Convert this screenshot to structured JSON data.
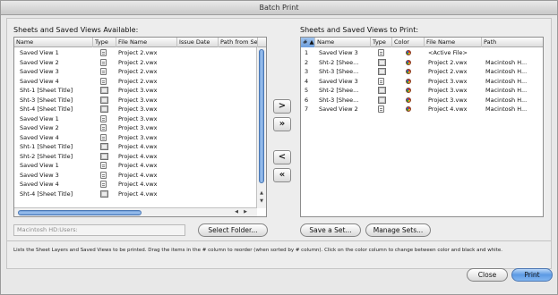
{
  "window": {
    "title": "Batch Print"
  },
  "available": {
    "label": "Sheets and Saved Views Available:",
    "columns": [
      "Name",
      "Type",
      "File Name",
      "Issue Date",
      "Path from Se"
    ],
    "rows": [
      {
        "name": "Saved View 1",
        "type": "doc",
        "file": "Project 2.vwx"
      },
      {
        "name": "Saved View 2",
        "type": "doc",
        "file": "Project 2.vwx"
      },
      {
        "name": "Saved View 3",
        "type": "doc",
        "file": "Project 2.vwx"
      },
      {
        "name": "Saved View 4",
        "type": "doc",
        "file": "Project 2.vwx"
      },
      {
        "name": "Sht-1 [Sheet Title]",
        "type": "sheet",
        "file": "Project 3.vwx"
      },
      {
        "name": "Sht-3 [Sheet Title]",
        "type": "sheet",
        "file": "Project 3.vwx"
      },
      {
        "name": "Sht-4 [Sheet Title]",
        "type": "sheet",
        "file": "Project 3.vwx"
      },
      {
        "name": "Saved View 1",
        "type": "doc",
        "file": "Project 3.vwx"
      },
      {
        "name": "Saved View 2",
        "type": "doc",
        "file": "Project 3.vwx"
      },
      {
        "name": "Saved View 4",
        "type": "doc",
        "file": "Project 3.vwx"
      },
      {
        "name": "Sht-1 [Sheet Title]",
        "type": "sheet",
        "file": "Project 4.vwx"
      },
      {
        "name": "Sht-2 [Sheet Title]",
        "type": "sheet",
        "file": "Project 4.vwx"
      },
      {
        "name": "Saved View 1",
        "type": "doc",
        "file": "Project 4.vwx"
      },
      {
        "name": "Saved View 3",
        "type": "doc",
        "file": "Project 4.vwx"
      },
      {
        "name": "Saved View 4",
        "type": "doc",
        "file": "Project 4.vwx"
      },
      {
        "name": "Sht-4 [Sheet Title]",
        "type": "sheet",
        "file": "Project 4.vwx"
      }
    ]
  },
  "to_print": {
    "label": "Sheets and Saved Views to Print:",
    "columns": [
      "#",
      "Name",
      "Type",
      "Color",
      "File Name",
      "Path"
    ],
    "rows": [
      {
        "num": "1",
        "name": "Saved View 3",
        "type": "doc",
        "file": "<Active File>",
        "path": ""
      },
      {
        "num": "2",
        "name": "Sht-2 [Shee...",
        "type": "sheet",
        "file": "Project 2.vwx",
        "path": "Macintosh H..."
      },
      {
        "num": "3",
        "name": "Sht-3 [Shee...",
        "type": "sheet",
        "file": "Project 2.vwx",
        "path": "Macintosh H..."
      },
      {
        "num": "4",
        "name": "Saved View 3",
        "type": "doc",
        "file": "Project 3.vwx",
        "path": "Macintosh H..."
      },
      {
        "num": "5",
        "name": "Sht-2 [Shee...",
        "type": "sheet",
        "file": "Project 3.vwx",
        "path": "Macintosh H..."
      },
      {
        "num": "6",
        "name": "Sht-3 [Shee...",
        "type": "sheet",
        "file": "Project 3.vwx",
        "path": "Macintosh H..."
      },
      {
        "num": "7",
        "name": "Saved View 2",
        "type": "doc",
        "file": "Project 4.vwx",
        "path": "Macintosh H..."
      }
    ]
  },
  "move_buttons": {
    "add": ">",
    "add_all": "»",
    "remove": "<",
    "remove_all": "«"
  },
  "path_field": {
    "value": "Macintosh HD:Users:"
  },
  "buttons": {
    "select_folder": "Select Folder...",
    "save_set": "Save a Set...",
    "manage_sets": "Manage Sets...",
    "close": "Close",
    "print": "Print"
  },
  "info_text": "Lists the Sheet Layers and Saved Views to be printed.  Drag the items in the # column to reorder (when sorted by # column).  Click on the color column to change between color and black and white."
}
